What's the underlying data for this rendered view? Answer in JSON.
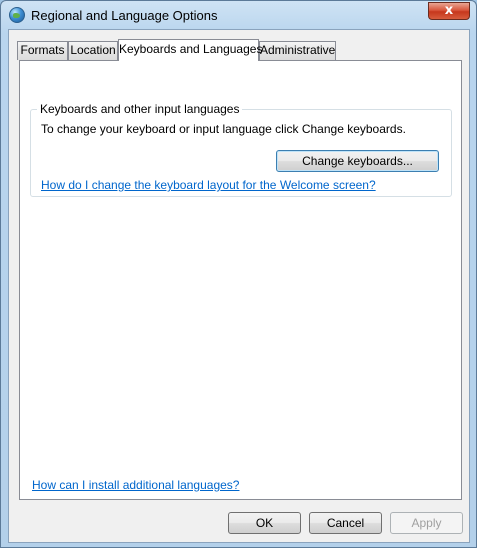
{
  "window": {
    "title": "Regional and Language Options",
    "close_label": "x"
  },
  "tabs": [
    {
      "label": "Formats"
    },
    {
      "label": "Location"
    },
    {
      "label": "Keyboards and Languages",
      "active": true
    },
    {
      "label": "Administrative"
    }
  ],
  "keyboards_group": {
    "caption": "Keyboards and other input languages",
    "description": "To change your keyboard or input language click Change keyboards.",
    "change_button": "Change keyboards...",
    "welcome_link": "How do I change the keyboard layout for the Welcome screen?"
  },
  "install_link": "How can I install additional languages?",
  "footer": {
    "ok": "OK",
    "cancel": "Cancel",
    "apply": "Apply"
  }
}
